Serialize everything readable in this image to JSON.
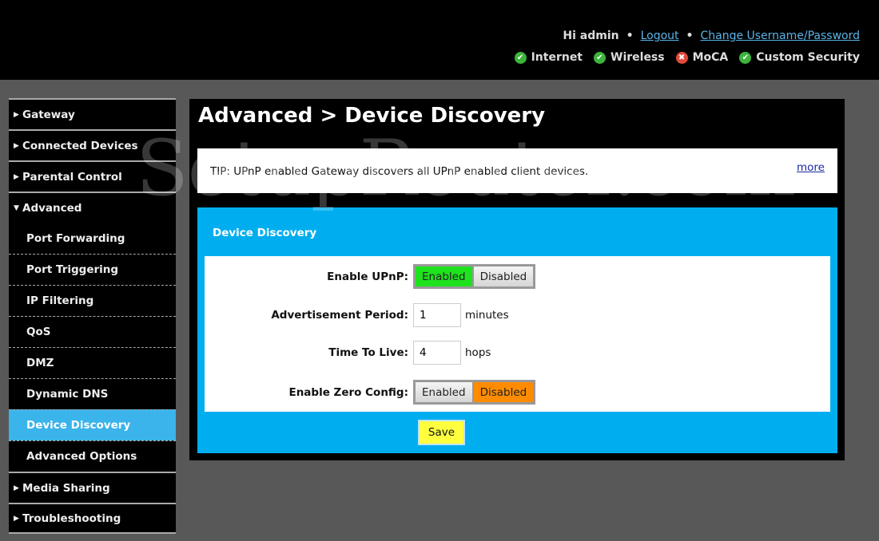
{
  "header": {
    "greeting": "Hi admin",
    "bullet": "•",
    "logout": "Logout",
    "change_credentials": "Change Username/Password",
    "statuses": [
      {
        "label": "Internet",
        "state": "ok",
        "icon": "check-circle-icon",
        "color": "#3cb43c"
      },
      {
        "label": "Wireless",
        "state": "ok",
        "icon": "check-circle-icon",
        "color": "#3cb43c"
      },
      {
        "label": "MoCA",
        "state": "error",
        "icon": "x-circle-icon",
        "color": "#e04a3a"
      },
      {
        "label": "Custom Security",
        "state": "ok",
        "icon": "check-circle-icon",
        "color": "#3cb43c"
      }
    ]
  },
  "sidebar": {
    "items": [
      {
        "label": "Gateway",
        "type": "top",
        "expanded": false
      },
      {
        "label": "Connected Devices",
        "type": "top",
        "expanded": false
      },
      {
        "label": "Parental Control",
        "type": "top",
        "expanded": false
      },
      {
        "label": "Advanced",
        "type": "top",
        "expanded": true
      },
      {
        "label": "Port Forwarding",
        "type": "sub"
      },
      {
        "label": "Port Triggering",
        "type": "sub"
      },
      {
        "label": "IP Filtering",
        "type": "sub"
      },
      {
        "label": "QoS",
        "type": "sub"
      },
      {
        "label": "DMZ",
        "type": "sub"
      },
      {
        "label": "Dynamic DNS",
        "type": "sub"
      },
      {
        "label": "Device Discovery",
        "type": "sub",
        "active": true
      },
      {
        "label": "Advanced Options",
        "type": "sub"
      },
      {
        "label": "Media Sharing",
        "type": "top",
        "expanded": false
      },
      {
        "label": "Troubleshooting",
        "type": "top",
        "expanded": false
      }
    ]
  },
  "main": {
    "title": "Advanced > Device Discovery",
    "tip": "TIP: UPnP enabled Gateway discovers all UPnP enabled client devices.",
    "more": "more",
    "section_title": "Device Discovery",
    "enable_upnp": {
      "label": "Enable UPnP:",
      "options": [
        "Enabled",
        "Disabled"
      ],
      "selected": "Enabled"
    },
    "advertisement_period": {
      "label": "Advertisement Period:",
      "value": "1",
      "unit": "minutes"
    },
    "time_to_live": {
      "label": "Time To Live:",
      "value": "4",
      "unit": "hops"
    },
    "enable_zero_config": {
      "label": "Enable Zero Config:",
      "options": [
        "Enabled",
        "Disabled"
      ],
      "selected": "Disabled"
    },
    "save": "Save"
  },
  "colors": {
    "accent": "#00aeef",
    "active_nav": "#3ab4ea",
    "enabled": "#1ee21e",
    "disabled": "#ff8c00",
    "save": "#ffff40"
  },
  "watermark": "SetupRouter.com"
}
